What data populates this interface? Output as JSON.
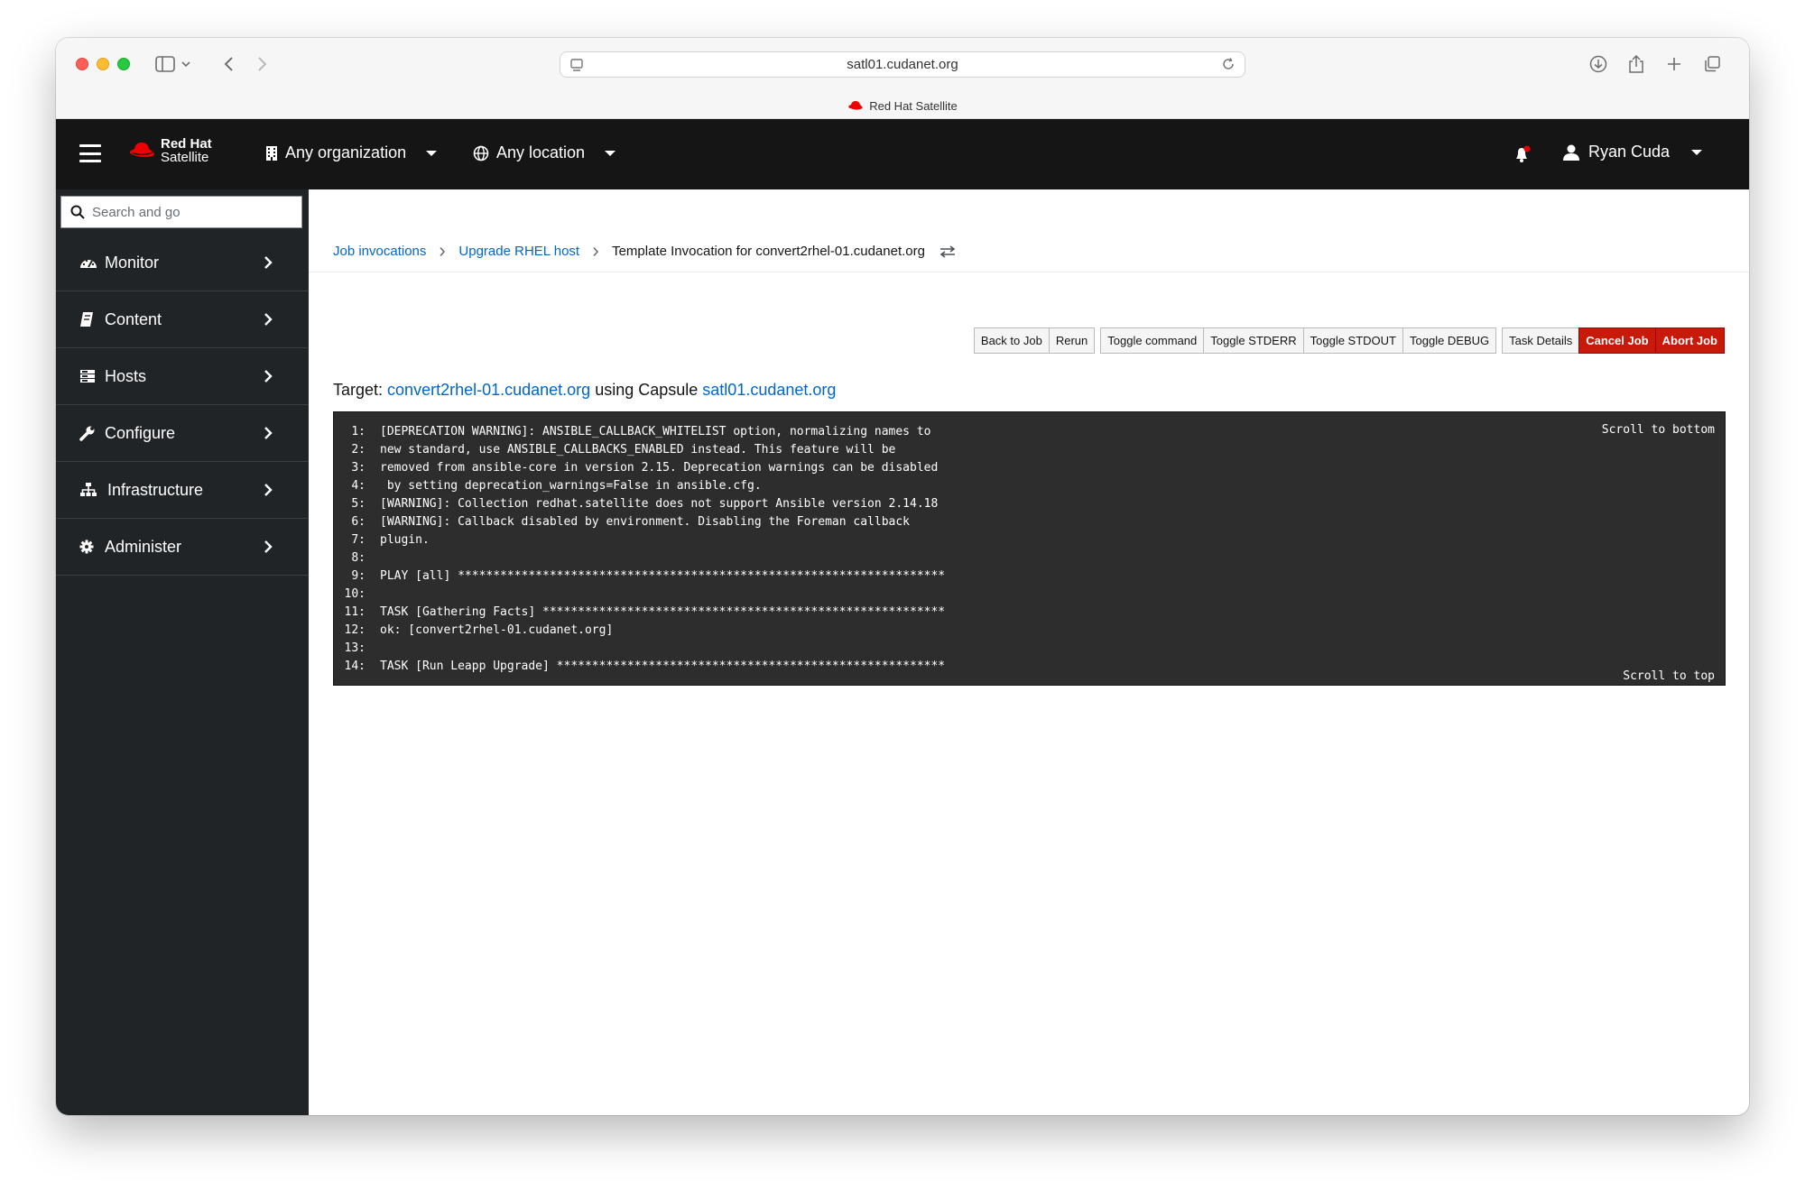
{
  "browser": {
    "url": "satl01.cudanet.org",
    "tab_title": "Red Hat Satellite"
  },
  "masthead": {
    "brand_line1": "Red Hat",
    "brand_line2": "Satellite",
    "organization": "Any organization",
    "location": "Any location",
    "user": "Ryan Cuda"
  },
  "sidebar": {
    "search_placeholder": "Search and go",
    "items": [
      {
        "label": "Monitor",
        "icon": "dashboard-icon"
      },
      {
        "label": "Content",
        "icon": "book-icon"
      },
      {
        "label": "Hosts",
        "icon": "server-icon"
      },
      {
        "label": "Configure",
        "icon": "wrench-icon"
      },
      {
        "label": "Infrastructure",
        "icon": "sitemap-icon"
      },
      {
        "label": "Administer",
        "icon": "gear-icon"
      }
    ]
  },
  "breadcrumb": {
    "job_invocations": "Job invocations",
    "upgrade_host": "Upgrade RHEL host",
    "current": "Template Invocation for convert2rhel-01.cudanet.org"
  },
  "buttons": {
    "back_to_job": "Back to Job",
    "rerun": "Rerun",
    "toggle_command": "Toggle command",
    "toggle_stderr": "Toggle STDERR",
    "toggle_stdout": "Toggle STDOUT",
    "toggle_debug": "Toggle DEBUG",
    "task_details": "Task Details",
    "cancel_job": "Cancel Job",
    "abort_job": "Abort Job"
  },
  "target": {
    "prefix": "Target:",
    "host": "convert2rhel-01.cudanet.org",
    "middle": "using Capsule",
    "capsule": "satl01.cudanet.org"
  },
  "console": {
    "scroll_bottom": "Scroll to bottom",
    "scroll_top": "Scroll to top",
    "lines": [
      {
        "n": "1:",
        "text": "[DEPRECATION WARNING]: ANSIBLE_CALLBACK_WHITELIST option, normalizing names to"
      },
      {
        "n": "2:",
        "text": "new standard, use ANSIBLE_CALLBACKS_ENABLED instead. This feature will be"
      },
      {
        "n": "3:",
        "text": "removed from ansible-core in version 2.15. Deprecation warnings can be disabled"
      },
      {
        "n": "4:",
        "text": " by setting deprecation_warnings=False in ansible.cfg."
      },
      {
        "n": "5:",
        "text": "[WARNING]: Collection redhat.satellite does not support Ansible version 2.14.18"
      },
      {
        "n": "6:",
        "text": "[WARNING]: Callback disabled by environment. Disabling the Foreman callback"
      },
      {
        "n": "7:",
        "text": "plugin."
      },
      {
        "n": "8:",
        "text": ""
      },
      {
        "n": "9:",
        "text": "PLAY [all] *********************************************************************"
      },
      {
        "n": "10:",
        "text": ""
      },
      {
        "n": "11:",
        "text": "TASK [Gathering Facts] *********************************************************"
      },
      {
        "n": "12:",
        "text": "ok: [convert2rhel-01.cudanet.org]"
      },
      {
        "n": "13:",
        "text": ""
      },
      {
        "n": "14:",
        "text": "TASK [Run Leapp Upgrade] *******************************************************"
      }
    ]
  }
}
